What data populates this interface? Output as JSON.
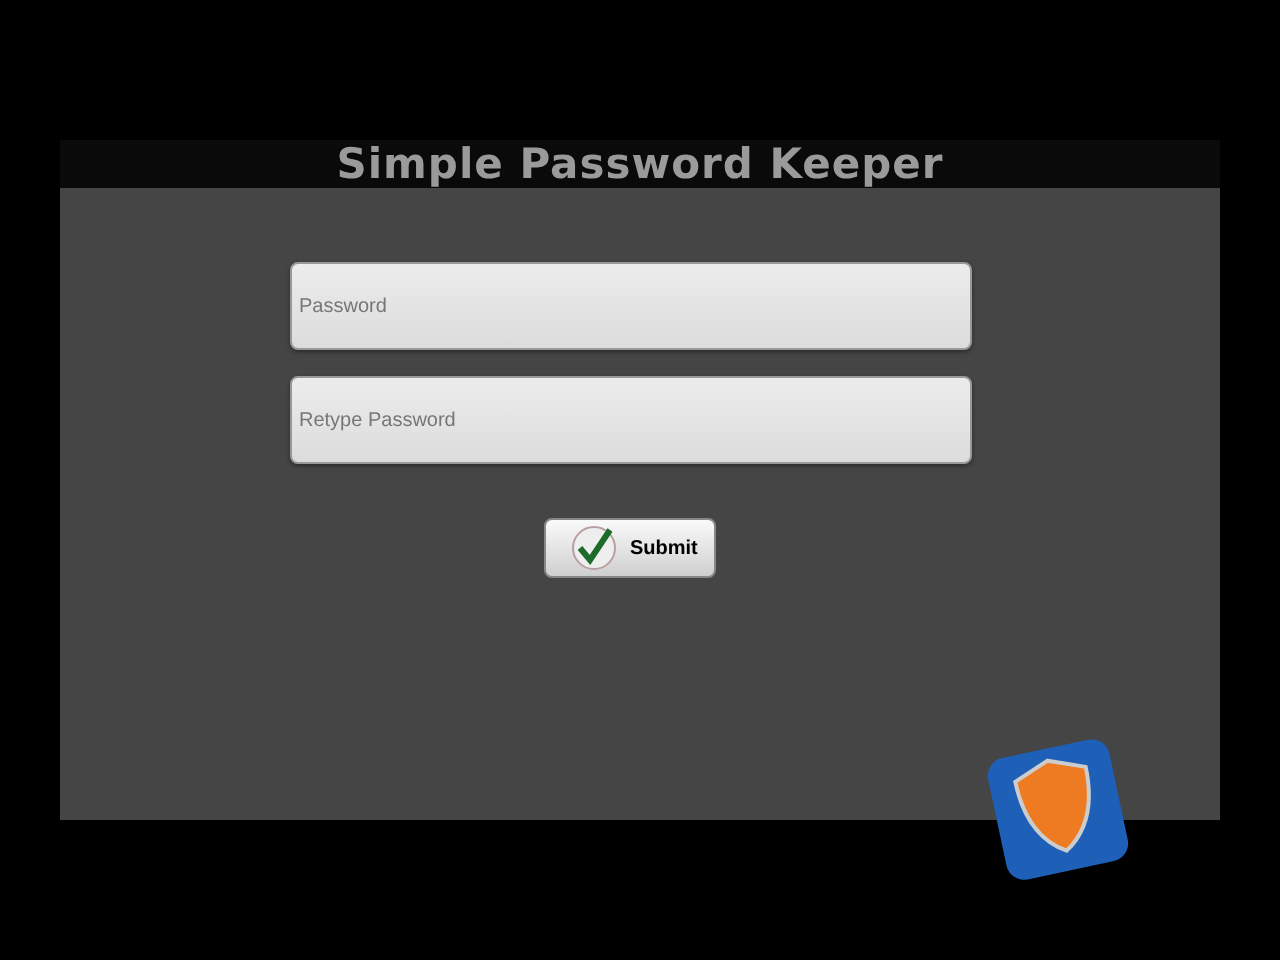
{
  "window": {
    "title": "Simple Password Keeper"
  },
  "fields": [
    {
      "placeholder": "Password"
    },
    {
      "placeholder": "Retype Password"
    }
  ],
  "submit_button": {
    "label": "Submit"
  }
}
